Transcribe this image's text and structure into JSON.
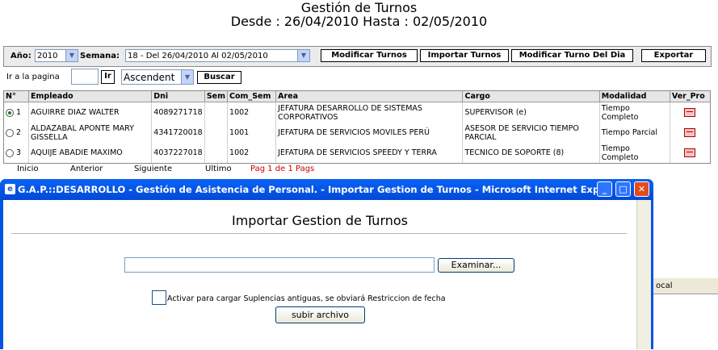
{
  "header": {
    "title": "Gestión de Turnos",
    "subtitle": "Desde : 26/04/2010 Hasta : 02/05/2010"
  },
  "toolbar": {
    "anio_label": "Año:",
    "anio_value": "2010",
    "semana_label": "Semana:",
    "semana_value": "18 - Del 26/04/2010 Al 02/05/2010",
    "btn_modificar_turnos": "Modificar Turnos",
    "btn_importar_turnos": "Importar Turnos",
    "btn_modificar_turno_dia": "Modificar Turno Del Dia",
    "btn_exportar": "Exportar"
  },
  "nav": {
    "ir_label": "Ir a la pagina",
    "ir_button": "Ir",
    "order_value": "Ascendent",
    "buscar_button": "Buscar"
  },
  "grid": {
    "columns": [
      "N°",
      "Empleado",
      "Dni",
      "Sem",
      "Com_Sem",
      "Area",
      "Cargo",
      "Modalidad",
      "Ver_Pro"
    ],
    "rows": [
      {
        "n": "1",
        "empleado": "AGUIRRE DIAZ WALTER",
        "dni": "4089271718",
        "sem": "",
        "com_sem": "1002",
        "area": "JEFATURA DESARROLLO DE SISTEMAS CORPORATIVOS",
        "cargo": "SUPERVISOR (e)",
        "modalidad": "Tiempo Completo"
      },
      {
        "n": "2",
        "empleado": "ALDAZABAL APONTE MARY GISSELLA",
        "dni": "4341720018",
        "sem": "",
        "com_sem": "1001",
        "area": "JEFATURA DE SERVICIOS MOVILES PERÚ",
        "cargo": "ASESOR DE SERVICIO TIEMPO PARCIAL",
        "modalidad": "Tiempo Parcial"
      },
      {
        "n": "3",
        "empleado": "AQUIJE ABADIE MAXIMO",
        "dni": "4037227018",
        "sem": "",
        "com_sem": "1002",
        "area": "JEFATURA DE SERVICIOS SPEEDY Y TERRA",
        "cargo": "TECNICO DE SOPORTE (8)",
        "modalidad": "Tiempo Completo"
      }
    ]
  },
  "pager": {
    "inicio": "Inicio",
    "anterior": "Anterior",
    "siguiente": "Siguiente",
    "ultimo": "Ultimo",
    "pag_text": "Pag 1 de 1 Pags"
  },
  "dialog": {
    "window_title": "G.A.P.::DESARROLLO - Gestión de Asistencia de Personal. - Importar Gestion de Turnos - Microsoft Internet Expl...",
    "heading": "Importar Gestion de Turnos",
    "file_value": "",
    "examinar": "Examinar...",
    "checkbox_label": "Activar para cargar Suplencias antiguas, se obviará Restriccion de fecha",
    "subir": "subir archivo"
  },
  "background": {
    "partial_text": "ocal"
  },
  "colors": {
    "titlebar": "#0055e5",
    "link_red": "#cc0000",
    "pag_blue": "#0000cc"
  }
}
